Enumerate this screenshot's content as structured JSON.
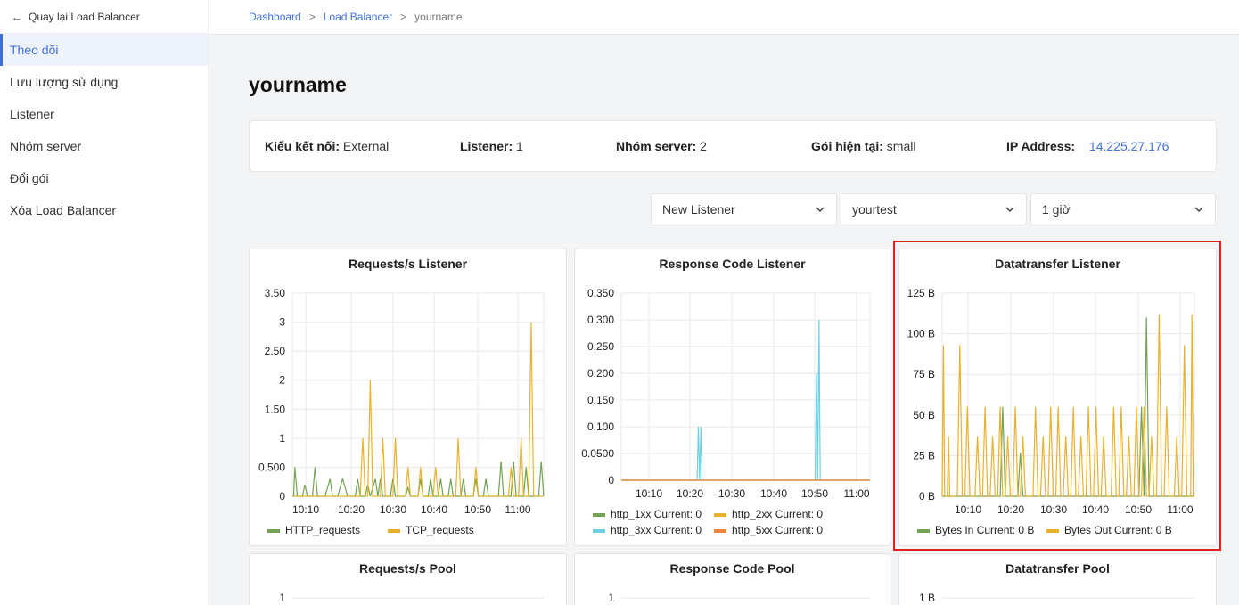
{
  "sidebar": {
    "back_label": "Quay lại Load Balancer",
    "items": [
      {
        "label": "Theo dõi",
        "active": true
      },
      {
        "label": "Lưu lượng sử dụng"
      },
      {
        "label": "Listener"
      },
      {
        "label": "Nhóm server"
      },
      {
        "label": "Đổi gói"
      },
      {
        "label": "Xóa Load Balancer"
      }
    ]
  },
  "breadcrumb": {
    "items": [
      "Dashboard",
      "Load Balancer"
    ],
    "current": "yourname",
    "separator": ">"
  },
  "page": {
    "title": "yourname"
  },
  "info": {
    "conn_label": "Kiểu kết nối:",
    "conn_value": "External",
    "listener_label": "Listener:",
    "listener_value": "1",
    "pool_label": "Nhóm server:",
    "pool_value": "2",
    "plan_label": "Gói hiện tại:",
    "plan_value": "small",
    "ip_label": "IP Address:",
    "ip_value": "14.225.27.176"
  },
  "filters": {
    "listener": "New Listener",
    "pool": "yourtest",
    "period": "1 giờ"
  },
  "colors": {
    "green": "#73a353",
    "yellow": "#e8b22c",
    "cyan": "#6ed0e0",
    "orange": "#ef843c",
    "highlight": "#e0211f"
  },
  "chart_data": [
    {
      "type": "line",
      "title": "Requests/s Listener",
      "y_ticks": [
        "0",
        "0.500",
        "1",
        "1.50",
        "2",
        "2.50",
        "3",
        "3.50"
      ],
      "ylim": [
        0,
        3.5
      ],
      "x_ticks": [
        "10:10",
        "10:20",
        "10:30",
        "10:40",
        "10:50",
        "11:00"
      ],
      "series": [
        {
          "name": "HTTP_requests",
          "color": "#73a353",
          "points": [
            [
              0.005,
              0
            ],
            [
              0.01,
              0.5
            ],
            [
              0.02,
              0
            ],
            [
              0.04,
              0
            ],
            [
              0.05,
              0.2
            ],
            [
              0.06,
              0
            ],
            [
              0.08,
              0
            ],
            [
              0.09,
              0.5
            ],
            [
              0.1,
              0
            ],
            [
              0.13,
              0
            ],
            [
              0.15,
              0.3
            ],
            [
              0.16,
              0
            ],
            [
              0.18,
              0
            ],
            [
              0.2,
              0.3
            ],
            [
              0.22,
              0
            ],
            [
              0.25,
              0
            ],
            [
              0.26,
              0.3
            ],
            [
              0.27,
              0
            ],
            [
              0.29,
              0
            ],
            [
              0.3,
              0.2
            ],
            [
              0.31,
              0
            ],
            [
              0.33,
              0.3
            ],
            [
              0.34,
              0
            ],
            [
              0.35,
              0.3
            ],
            [
              0.36,
              0
            ],
            [
              0.39,
              0
            ],
            [
              0.4,
              0.3
            ],
            [
              0.41,
              0
            ],
            [
              0.45,
              0
            ],
            [
              0.46,
              0.15
            ],
            [
              0.47,
              0
            ],
            [
              0.5,
              0
            ],
            [
              0.51,
              0.3
            ],
            [
              0.52,
              0
            ],
            [
              0.54,
              0
            ],
            [
              0.55,
              0.3
            ],
            [
              0.56,
              0
            ],
            [
              0.58,
              0
            ],
            [
              0.59,
              0.3
            ],
            [
              0.6,
              0
            ],
            [
              0.62,
              0
            ],
            [
              0.63,
              0.3
            ],
            [
              0.64,
              0
            ],
            [
              0.67,
              0
            ],
            [
              0.68,
              0.3
            ],
            [
              0.69,
              0
            ],
            [
              0.72,
              0
            ],
            [
              0.73,
              0.3
            ],
            [
              0.74,
              0
            ],
            [
              0.76,
              0
            ],
            [
              0.77,
              0.3
            ],
            [
              0.78,
              0
            ],
            [
              0.82,
              0
            ],
            [
              0.83,
              0.6
            ],
            [
              0.84,
              0
            ],
            [
              0.87,
              0
            ],
            [
              0.88,
              0.6
            ],
            [
              0.89,
              0
            ],
            [
              0.92,
              0
            ],
            [
              0.93,
              0.5
            ],
            [
              0.94,
              0
            ],
            [
              0.98,
              0
            ],
            [
              0.99,
              0.6
            ],
            [
              1,
              0
            ]
          ]
        },
        {
          "name": "TCP_requests",
          "color": "#e8b22c",
          "points": [
            [
              0,
              0
            ],
            [
              0.27,
              0
            ],
            [
              0.28,
              1
            ],
            [
              0.29,
              0
            ],
            [
              0.3,
              0
            ],
            [
              0.31,
              2
            ],
            [
              0.32,
              0
            ],
            [
              0.35,
              0
            ],
            [
              0.36,
              1
            ],
            [
              0.37,
              0
            ],
            [
              0.4,
              0
            ],
            [
              0.41,
              1
            ],
            [
              0.42,
              0
            ],
            [
              0.45,
              0
            ],
            [
              0.46,
              0.5
            ],
            [
              0.47,
              0
            ],
            [
              0.5,
              0
            ],
            [
              0.51,
              0.5
            ],
            [
              0.52,
              0
            ],
            [
              0.56,
              0
            ],
            [
              0.57,
              0.5
            ],
            [
              0.58,
              0
            ],
            [
              0.65,
              0
            ],
            [
              0.66,
              1
            ],
            [
              0.67,
              0
            ],
            [
              0.72,
              0
            ],
            [
              0.73,
              0.5
            ],
            [
              0.74,
              0
            ],
            [
              0.86,
              0
            ],
            [
              0.87,
              0.5
            ],
            [
              0.88,
              0
            ],
            [
              0.9,
              0
            ],
            [
              0.91,
              1
            ],
            [
              0.92,
              0
            ],
            [
              0.94,
              0
            ],
            [
              0.95,
              3
            ],
            [
              0.96,
              0
            ],
            [
              1,
              0
            ]
          ]
        }
      ]
    },
    {
      "type": "line",
      "title": "Response Code Listener",
      "y_ticks": [
        "0",
        "0.0500",
        "0.100",
        "0.150",
        "0.200",
        "0.250",
        "0.300",
        "0.350"
      ],
      "ylim": [
        0,
        0.35
      ],
      "x_ticks": [
        "10:10",
        "10:20",
        "10:30",
        "10:40",
        "10:50",
        "11:00"
      ],
      "series": [
        {
          "name": "http_1xx",
          "current_label": "Current:",
          "current": "0",
          "color": "#73a353",
          "points": [
            [
              0,
              0
            ],
            [
              1,
              0
            ]
          ]
        },
        {
          "name": "http_2xx",
          "current_label": "Current:",
          "current": "0",
          "color": "#e8b22c",
          "points": [
            [
              0,
              0
            ],
            [
              1,
              0
            ]
          ]
        },
        {
          "name": "http_3xx",
          "current_label": "Current:",
          "current": "0",
          "color": "#6ed0e0",
          "points": [
            [
              0,
              0
            ],
            [
              0.305,
              0
            ],
            [
              0.31,
              0.1
            ],
            [
              0.315,
              0
            ],
            [
              0.32,
              0.1
            ],
            [
              0.325,
              0
            ],
            [
              0.78,
              0
            ],
            [
              0.785,
              0.2
            ],
            [
              0.79,
              0
            ],
            [
              0.795,
              0.3
            ],
            [
              0.8,
              0
            ],
            [
              1,
              0
            ]
          ]
        },
        {
          "name": "http_5xx",
          "current_label": "Current:",
          "current": "0",
          "color": "#ef843c",
          "points": [
            [
              0,
              0
            ],
            [
              1,
              0
            ]
          ]
        }
      ]
    },
    {
      "type": "line",
      "title": "Datatransfer Listener",
      "y_ticks": [
        "0 B",
        "25 B",
        "50 B",
        "75 B",
        "100 B",
        "125 B"
      ],
      "ylim": [
        0,
        125
      ],
      "x_ticks": [
        "10:10",
        "10:20",
        "10:30",
        "10:40",
        "10:50",
        "11:00"
      ],
      "series": [
        {
          "name": "Bytes In",
          "current_label": "Current:",
          "current": "0 B",
          "color": "#73a353",
          "points": [
            [
              0,
              0
            ],
            [
              0.23,
              0
            ],
            [
              0.24,
              55
            ],
            [
              0.25,
              0
            ],
            [
              0.3,
              0
            ],
            [
              0.31,
              27
            ],
            [
              0.32,
              0
            ],
            [
              0.78,
              0
            ],
            [
              0.79,
              55
            ],
            [
              0.8,
              0
            ],
            [
              0.8,
              0
            ],
            [
              0.81,
              110
            ],
            [
              0.82,
              0
            ],
            [
              1,
              0
            ]
          ]
        },
        {
          "name": "Bytes Out",
          "current_label": "Current:",
          "current": "0 B",
          "color": "#e8b22c",
          "points": [
            [
              0,
              0
            ],
            [
              0.005,
              93
            ],
            [
              0.01,
              0
            ],
            [
              0.02,
              0
            ],
            [
              0.025,
              37
            ],
            [
              0.03,
              0
            ],
            [
              0.06,
              0
            ],
            [
              0.07,
              93
            ],
            [
              0.08,
              0
            ],
            [
              0.09,
              0
            ],
            [
              0.1,
              55
            ],
            [
              0.11,
              0
            ],
            [
              0.13,
              0
            ],
            [
              0.14,
              37
            ],
            [
              0.15,
              0
            ],
            [
              0.16,
              0
            ],
            [
              0.17,
              55
            ],
            [
              0.18,
              0
            ],
            [
              0.19,
              0
            ],
            [
              0.2,
              37
            ],
            [
              0.21,
              0
            ],
            [
              0.22,
              0
            ],
            [
              0.23,
              55
            ],
            [
              0.24,
              0
            ],
            [
              0.25,
              0
            ],
            [
              0.26,
              37
            ],
            [
              0.27,
              0
            ],
            [
              0.28,
              0
            ],
            [
              0.29,
              55
            ],
            [
              0.3,
              0
            ],
            [
              0.31,
              0
            ],
            [
              0.32,
              37
            ],
            [
              0.33,
              0
            ],
            [
              0.36,
              0
            ],
            [
              0.37,
              55
            ],
            [
              0.38,
              0
            ],
            [
              0.39,
              0
            ],
            [
              0.4,
              37
            ],
            [
              0.41,
              0
            ],
            [
              0.42,
              0
            ],
            [
              0.43,
              55
            ],
            [
              0.44,
              0
            ],
            [
              0.45,
              0
            ],
            [
              0.46,
              55
            ],
            [
              0.47,
              0
            ],
            [
              0.48,
              0
            ],
            [
              0.49,
              37
            ],
            [
              0.5,
              0
            ],
            [
              0.51,
              0
            ],
            [
              0.52,
              55
            ],
            [
              0.53,
              0
            ],
            [
              0.54,
              0
            ],
            [
              0.55,
              37
            ],
            [
              0.56,
              0
            ],
            [
              0.57,
              0
            ],
            [
              0.58,
              55
            ],
            [
              0.59,
              0
            ],
            [
              0.6,
              0
            ],
            [
              0.61,
              55
            ],
            [
              0.62,
              0
            ],
            [
              0.63,
              0
            ],
            [
              0.64,
              37
            ],
            [
              0.65,
              0
            ],
            [
              0.67,
              0
            ],
            [
              0.68,
              55
            ],
            [
              0.69,
              0
            ],
            [
              0.7,
              0
            ],
            [
              0.71,
              55
            ],
            [
              0.72,
              0
            ],
            [
              0.73,
              0
            ],
            [
              0.74,
              37
            ],
            [
              0.75,
              0
            ],
            [
              0.76,
              0
            ],
            [
              0.77,
              55
            ],
            [
              0.78,
              0
            ],
            [
              0.79,
              0
            ],
            [
              0.8,
              55
            ],
            [
              0.81,
              0
            ],
            [
              0.82,
              0
            ],
            [
              0.83,
              37
            ],
            [
              0.84,
              0
            ],
            [
              0.85,
              0
            ],
            [
              0.86,
              112
            ],
            [
              0.87,
              0
            ],
            [
              0.88,
              0
            ],
            [
              0.89,
              55
            ],
            [
              0.9,
              0
            ],
            [
              0.92,
              0
            ],
            [
              0.93,
              37
            ],
            [
              0.94,
              0
            ],
            [
              0.95,
              0
            ],
            [
              0.96,
              93
            ],
            [
              0.97,
              0
            ],
            [
              0.985,
              0
            ],
            [
              0.99,
              112
            ],
            [
              0.995,
              0
            ],
            [
              1,
              0
            ]
          ]
        }
      ]
    },
    {
      "type": "line",
      "title": "Requests/s Pool",
      "y_ticks": [
        "1"
      ],
      "series": []
    },
    {
      "type": "line",
      "title": "Response Code Pool",
      "y_ticks": [
        "1"
      ],
      "series": []
    },
    {
      "type": "line",
      "title": "Datatransfer Pool",
      "y_ticks": [
        "1 B"
      ],
      "series": []
    }
  ]
}
